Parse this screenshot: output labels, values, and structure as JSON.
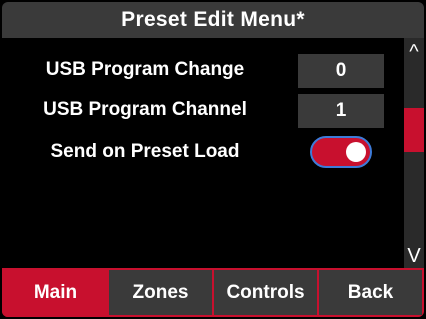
{
  "title": "Preset Edit Menu*",
  "rows": [
    {
      "label": "USB Program Change",
      "value": "0"
    },
    {
      "label": "USB Program Channel",
      "value": "1"
    },
    {
      "label": "Send on Preset Load",
      "toggle_on": true
    }
  ],
  "scrollbar": {
    "up_arrow": "^",
    "down_arrow": "V"
  },
  "tabs": [
    {
      "label": "Main",
      "active": true
    },
    {
      "label": "Zones",
      "active": false
    },
    {
      "label": "Controls",
      "active": false
    },
    {
      "label": "Back",
      "active": false
    }
  ],
  "colors": {
    "accent": "#c8102e",
    "panel": "#3a3a3a",
    "toggle_outline": "#3d7bd8"
  }
}
